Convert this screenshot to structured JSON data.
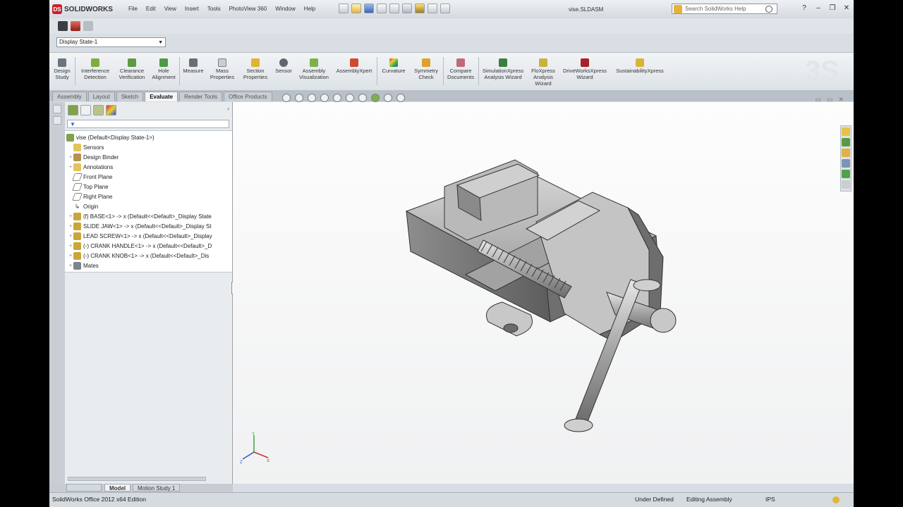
{
  "app": {
    "brand": "SOLIDWORKS",
    "menu": [
      "File",
      "Edit",
      "View",
      "Insert",
      "Tools",
      "PhotoView 360",
      "Window",
      "Help"
    ],
    "document_title": "vise.SLDASM",
    "help_search_placeholder": "Search SolidWorks Help"
  },
  "display_state": {
    "value": "Display State-1"
  },
  "command_manager": {
    "tools": [
      {
        "label": "Design\nStudy",
        "icon": "design-study-icon"
      },
      {
        "label": "Interference\nDetection",
        "icon": "interference-icon"
      },
      {
        "label": "Clearance\nVerification",
        "icon": "clearance-icon"
      },
      {
        "label": "Hole\nAlignment",
        "icon": "hole-alignment-icon"
      },
      {
        "label": "Measure",
        "icon": "measure-icon"
      },
      {
        "label": "Mass\nProperties",
        "icon": "mass-properties-icon"
      },
      {
        "label": "Section\nProperties",
        "icon": "section-properties-icon"
      },
      {
        "label": "Sensor",
        "icon": "sensor-icon"
      },
      {
        "label": "Assembly\nVisualization",
        "icon": "assembly-visualization-icon"
      },
      {
        "label": "AssemblyXpert",
        "icon": "assemblyxpert-icon"
      },
      {
        "label": "Curvature",
        "icon": "curvature-icon"
      },
      {
        "label": "Symmetry\nCheck",
        "icon": "symmetry-icon"
      },
      {
        "label": "Compare\nDocuments",
        "icon": "compare-icon"
      },
      {
        "label": "SimulationXpress\nAnalysis Wizard",
        "icon": "simulationxpress-icon"
      },
      {
        "label": "FloXpress\nAnalysis\nWizard",
        "icon": "floxpress-icon"
      },
      {
        "label": "DriveWorksXpress\nWizard",
        "icon": "driveworksxpress-icon"
      },
      {
        "label": "SustainabilityXpress",
        "icon": "sustainabilityxpress-icon"
      }
    ]
  },
  "tabs": [
    "Assembly",
    "Layout",
    "Sketch",
    "Evaluate",
    "Render Tools",
    "Office Products"
  ],
  "active_tab": "Evaluate",
  "feature_tree": {
    "root": "vise  (Default<Display State-1>)",
    "items": [
      {
        "label": "Sensors",
        "icon": "sensors-folder-icon"
      },
      {
        "label": "Design Binder",
        "icon": "design-binder-icon"
      },
      {
        "label": "Annotations",
        "icon": "annotations-icon"
      },
      {
        "label": "Front Plane",
        "icon": "plane-icon"
      },
      {
        "label": "Top Plane",
        "icon": "plane-icon"
      },
      {
        "label": "Right Plane",
        "icon": "plane-icon"
      },
      {
        "label": "Origin",
        "icon": "origin-icon"
      },
      {
        "label": "(f) BASE<1> -> x (Default<<Default>_Display State",
        "icon": "part-icon"
      },
      {
        "label": "SLIDE JAW<1> -> x (Default<<Default>_Display St",
        "icon": "part-icon"
      },
      {
        "label": "LEAD SCREW<1> -> x (Default<<Default>_Display",
        "icon": "part-icon"
      },
      {
        "label": "(-) CRANK HANDLE<1> -> x (Default<<Default>_D",
        "icon": "part-icon"
      },
      {
        "label": "(-) CRANK KNOB<1> -> x (Default<<Default>_Dis",
        "icon": "part-icon"
      },
      {
        "label": "Mates",
        "icon": "mates-icon"
      }
    ]
  },
  "bottom_tabs": [
    "Model",
    "Motion Study 1"
  ],
  "status_bar": {
    "edition": "SolidWorks Office 2012 x64 Edition",
    "state": "Under Defined",
    "mode": "Editing Assembly",
    "units": "IPS"
  }
}
